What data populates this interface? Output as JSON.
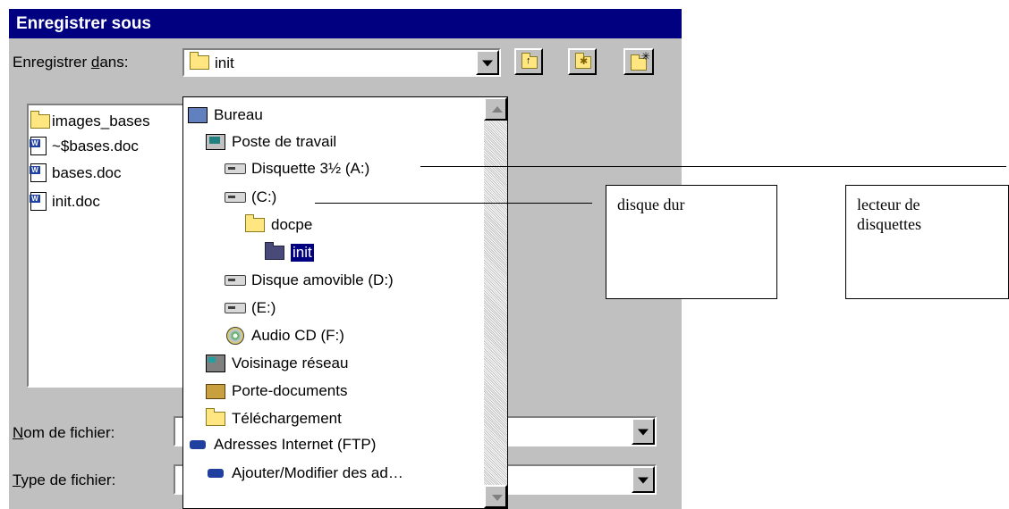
{
  "dialog": {
    "title": "Enregistrer sous",
    "save_in_label_pre": "Enregistrer ",
    "save_in_label_ul": "d",
    "save_in_label_post": "ans:",
    "current_folder": "init",
    "toolbar": {
      "up_icon": "folder-up-icon",
      "favorites_icon": "favorites-folder-icon",
      "new_folder_icon": "new-folder-icon"
    },
    "files": [
      {
        "name": "images_bases",
        "icon": "folder-icon"
      },
      {
        "name": "~$bases.doc",
        "icon": "word-doc-icon"
      },
      {
        "name": "bases.doc",
        "icon": "word-doc-icon"
      },
      {
        "name": "init.doc",
        "icon": "word-doc-icon"
      }
    ],
    "filename_label_ul": "N",
    "filename_label_post": "om de fichier:",
    "filetype_label_ul": "T",
    "filetype_label_post": "ype de fichier:",
    "filename_value": "",
    "filetype_value": ""
  },
  "dropdown": {
    "items": [
      {
        "label": "Bureau",
        "icon": "desktop-icon"
      },
      {
        "label": "Poste de travail",
        "icon": "computer-icon"
      },
      {
        "label": "Disquette 3½ (A:)",
        "icon": "floppy-drive-icon"
      },
      {
        "label": "(C:)",
        "icon": "hard-drive-icon"
      },
      {
        "label": "docpe",
        "icon": "folder-icon"
      },
      {
        "label": "init",
        "icon": "open-folder-icon",
        "selected": true
      },
      {
        "label": "Disque amovible (D:)",
        "icon": "removable-drive-icon"
      },
      {
        "label": "(E:)",
        "icon": "drive-icon"
      },
      {
        "label": "Audio CD (F:)",
        "icon": "cd-icon"
      },
      {
        "label": "Voisinage réseau",
        "icon": "network-icon"
      },
      {
        "label": "Porte-documents",
        "icon": "briefcase-icon"
      },
      {
        "label": "Téléchargement",
        "icon": "folder-icon"
      },
      {
        "label": "Adresses Internet (FTP)",
        "icon": "ftp-icon"
      },
      {
        "label": "Ajouter/Modifier des ad…",
        "icon": "ftp-icon"
      }
    ]
  },
  "annotations": {
    "hard_disk": "disque dur",
    "floppy_reader_line1": "lecteur de",
    "floppy_reader_line2": "disquettes"
  },
  "colors": {
    "titlebar": "#000080",
    "window": "#c0c0c0",
    "selection": "#000080"
  }
}
